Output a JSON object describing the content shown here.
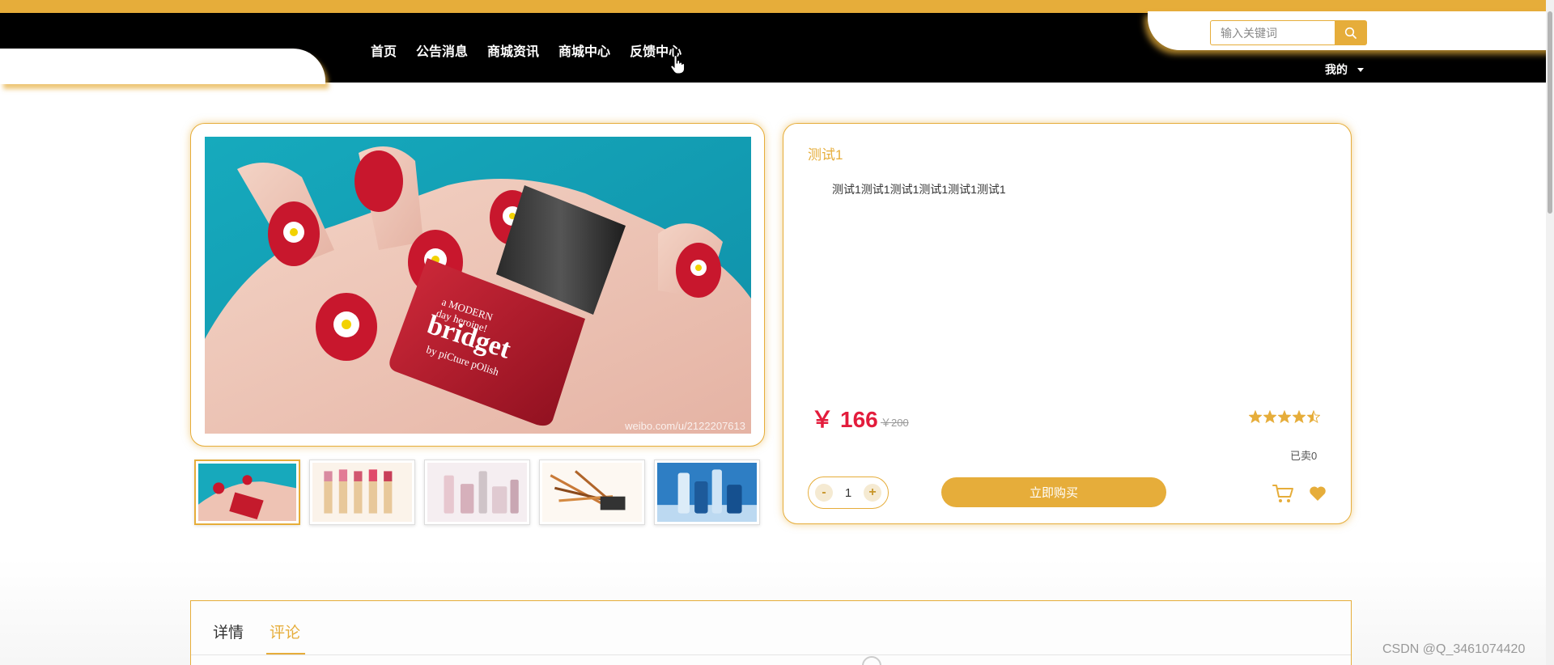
{
  "header": {
    "nav": [
      "首页",
      "公告消息",
      "商城资讯",
      "商城中心",
      "反馈中心"
    ],
    "search_placeholder": "输入关键词",
    "mine_label": "我的"
  },
  "product": {
    "title": "测试1",
    "description": "测试1测试1测试1测试1测试1测试1",
    "currency": "￥",
    "price": "166",
    "original_price": "￥200",
    "rating": 4.5,
    "sold_label": "已卖0",
    "quantity": "1",
    "qty_minus": "-",
    "qty_plus": "+",
    "buy_label": "立即购买",
    "image_watermark": "weibo.com/u/2122207613"
  },
  "thumbnails": [
    "nail-polish",
    "lipsticks",
    "cosmetic-bottles",
    "makeup-brushes",
    "skincare-bottles"
  ],
  "tabs": [
    "详情",
    "评论"
  ],
  "active_tab": "评论",
  "watermark": "CSDN @Q_3461074420",
  "colors": {
    "accent": "#e6ad3a",
    "price": "#e31c3c",
    "nav_bg": "#000000"
  }
}
